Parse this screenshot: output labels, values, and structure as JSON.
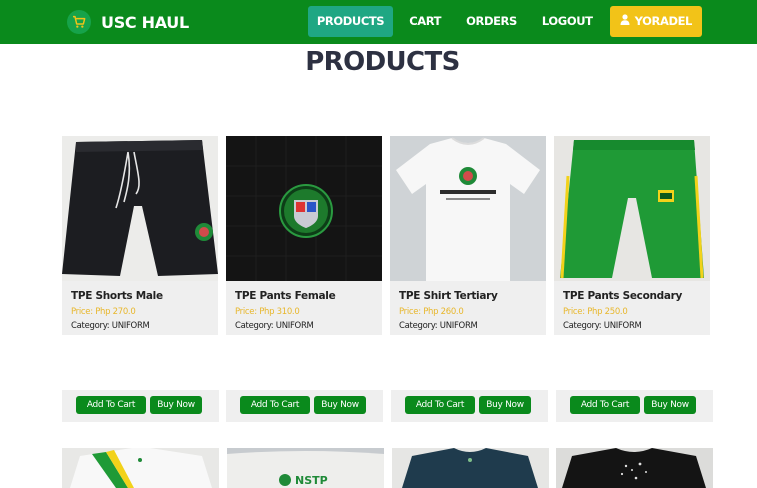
{
  "brand": {
    "name": "USC HAUL",
    "icon": "shopping-cart-icon"
  },
  "nav": {
    "products": "PRODUCTS",
    "cart": "CART",
    "orders": "ORDERS",
    "logout": "LOGOUT",
    "user": "YORADEL",
    "user_icon": "user-icon"
  },
  "page": {
    "title": "PRODUCTS"
  },
  "colors": {
    "navbar": "#0a8a1c",
    "active": "#1fa783",
    "user": "#f2c318",
    "price": "#e8b72c",
    "button": "#0a8a1c"
  },
  "products": [
    {
      "name": "TPE Shorts Male",
      "price": "Price: Php 270.0",
      "category": "Category: UNIFORM",
      "add": "Add To Cart",
      "buy": "Buy Now"
    },
    {
      "name": "TPE Pants Female",
      "price": "Price: Php 310.0",
      "category": "Category: UNIFORM",
      "add": "Add To Cart",
      "buy": "Buy Now"
    },
    {
      "name": "TPE Shirt Tertiary",
      "price": "Price: Php 260.0",
      "category": "Category: UNIFORM",
      "add": "Add To Cart",
      "buy": "Buy Now"
    },
    {
      "name": "TPE Pants Secondary",
      "price": "Price: Php 250.0",
      "category": "Category: UNIFORM",
      "add": "Add To Cart",
      "buy": "Buy Now"
    }
  ],
  "row2": {
    "nstp_text": "NSTP"
  }
}
